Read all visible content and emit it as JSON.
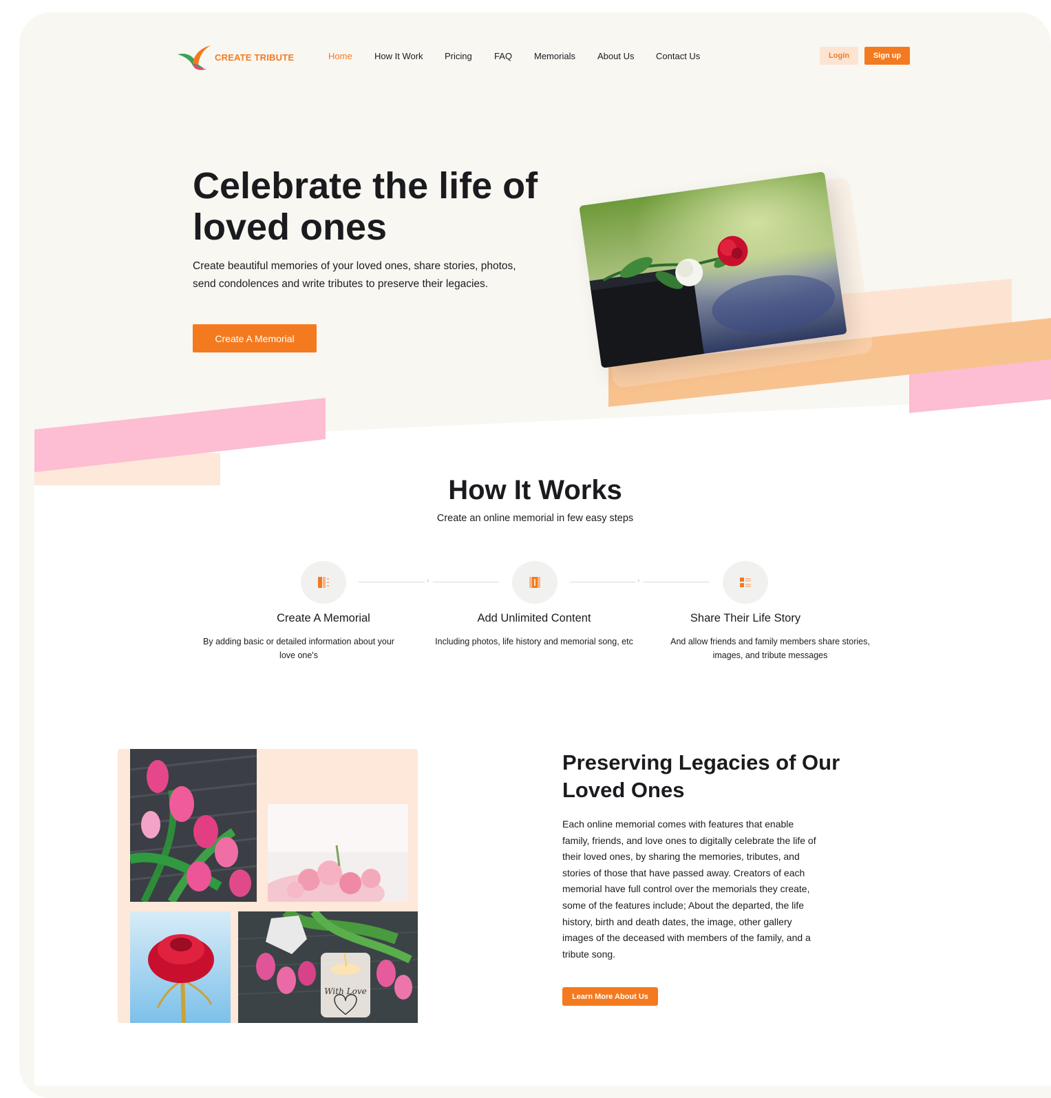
{
  "brand": {
    "name": "CREATE TRIBUTE",
    "accent": "#f47a1f",
    "pink": "#fdbdd2",
    "peach": "#f8c28f"
  },
  "nav": {
    "items": [
      {
        "label": "Home",
        "active": true
      },
      {
        "label": "How It Work"
      },
      {
        "label": "Pricing"
      },
      {
        "label": "FAQ"
      },
      {
        "label": "Memorials"
      },
      {
        "label": "About Us"
      },
      {
        "label": "Contact Us"
      }
    ],
    "login": "Login",
    "signup": "Sign up"
  },
  "hero": {
    "title": "Celebrate the life of loved ones",
    "subtitle": "Create beautiful memories of your loved ones, share stories, photos, send condolences and write tributes to preserve their legacies.",
    "cta": "Create A Memorial"
  },
  "how": {
    "title": "How It Works",
    "subtitle": "Create an online memorial in few easy steps",
    "steps": [
      {
        "icon": "memorial-icon",
        "title": "Create A Memorial",
        "text": "By adding basic or detailed information about your love one's"
      },
      {
        "icon": "content-icon",
        "title": "Add Unlimited Content",
        "text": "Including photos, life history and memorial song, etc"
      },
      {
        "icon": "share-icon",
        "title": "Share Their Life Story",
        "text": "And allow friends and family members share stories, images, and tribute messages"
      }
    ]
  },
  "legacy": {
    "title": "Preserving Legacies of Our Loved Ones",
    "text": "Each online memorial comes with features that enable family, friends, and love ones to digitally celebrate the life of their loved ones, by sharing the memories, tributes, and stories of those that have passed away. Creators of each memorial have full control over the memorials they create, some of the features include; About the departed, the life history, birth and death dates, the image, other gallery images of the deceased with members of the family, and a tribute song.",
    "cta": "Learn More About Us",
    "candle_text": "With Love"
  }
}
